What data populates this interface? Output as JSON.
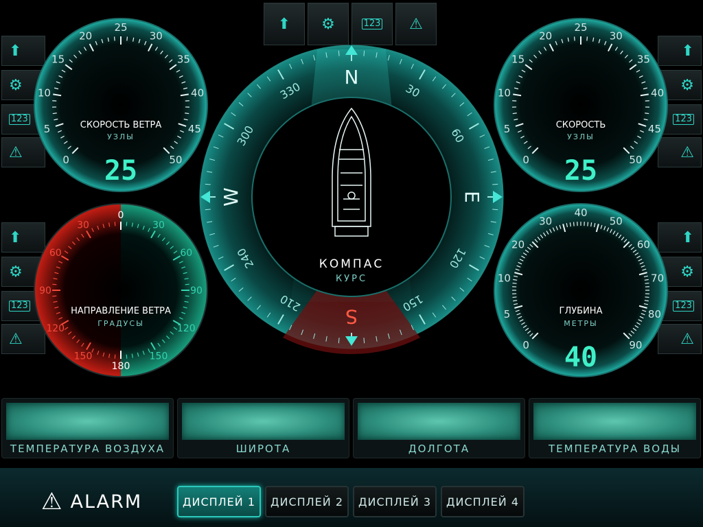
{
  "top_toolbar": {
    "buttons": [
      {
        "name": "up-arrow-icon",
        "glyph": "⬆"
      },
      {
        "name": "gear-icon",
        "glyph": "⚙"
      },
      {
        "name": "numbers-icon",
        "glyph": "123"
      },
      {
        "name": "warning-icon",
        "glyph": "⚠"
      }
    ]
  },
  "side_buttons": {
    "up": "⬆",
    "gear": "⚙",
    "num": "123",
    "warn": "⚠"
  },
  "gauges": {
    "wind_speed": {
      "title": "СКОРОСТЬ ВЕТРА",
      "unit": "УЗЛЫ",
      "value": "25",
      "ticks": [
        "0",
        "5",
        "10",
        "15",
        "20",
        "25",
        "30",
        "35",
        "40",
        "45",
        "50"
      ]
    },
    "speed": {
      "title": "СКОРОСТЬ",
      "unit": "УЗЛЫ",
      "value": "25",
      "ticks": [
        "0",
        "5",
        "10",
        "15",
        "20",
        "25",
        "30",
        "35",
        "40",
        "45",
        "50"
      ]
    },
    "wind_direction": {
      "title": "НАПРАВЛЕНИЕ ВЕТРА",
      "unit": "ГРАДУСЫ",
      "top": "0",
      "bottom": "180",
      "left": [
        "30",
        "60",
        "90",
        "120",
        "150"
      ],
      "right": [
        "30",
        "60",
        "90",
        "120",
        "150"
      ]
    },
    "depth": {
      "title": "ГЛУБИНА",
      "unit": "МЕТРЫ",
      "value": "40",
      "ticks": [
        "0",
        "5",
        "10",
        "20",
        "30",
        "40",
        "50",
        "60",
        "70",
        "80",
        "90"
      ]
    },
    "compass": {
      "title": "КОМПАС",
      "subtitle": "КУРС",
      "cardinals": {
        "n": "N",
        "e": "E",
        "s": "S",
        "w": "W"
      },
      "degrees": [
        "30",
        "60",
        "120",
        "150",
        "210",
        "240",
        "300",
        "330"
      ]
    }
  },
  "info_panels": [
    {
      "label": "ТЕМПЕРАТУРА ВОЗДУХА"
    },
    {
      "label": "ШИРОТА"
    },
    {
      "label": "ДОЛГОТА"
    },
    {
      "label": "ТЕМПЕРАТУРА ВОДЫ"
    }
  ],
  "bottom": {
    "alarm_icon": "⚠",
    "alarm_label": "ALARM",
    "displays": [
      "ДИСПЛЕЙ 1",
      "ДИСПЛЕЙ 2",
      "ДИСПЛЕЙ 3",
      "ДИСПЛЕЙ 4"
    ],
    "active_display": 0
  },
  "colors": {
    "accent": "#2fd6c6",
    "bg": "#000000",
    "danger": "#c8261e",
    "safe": "#1fa082"
  }
}
